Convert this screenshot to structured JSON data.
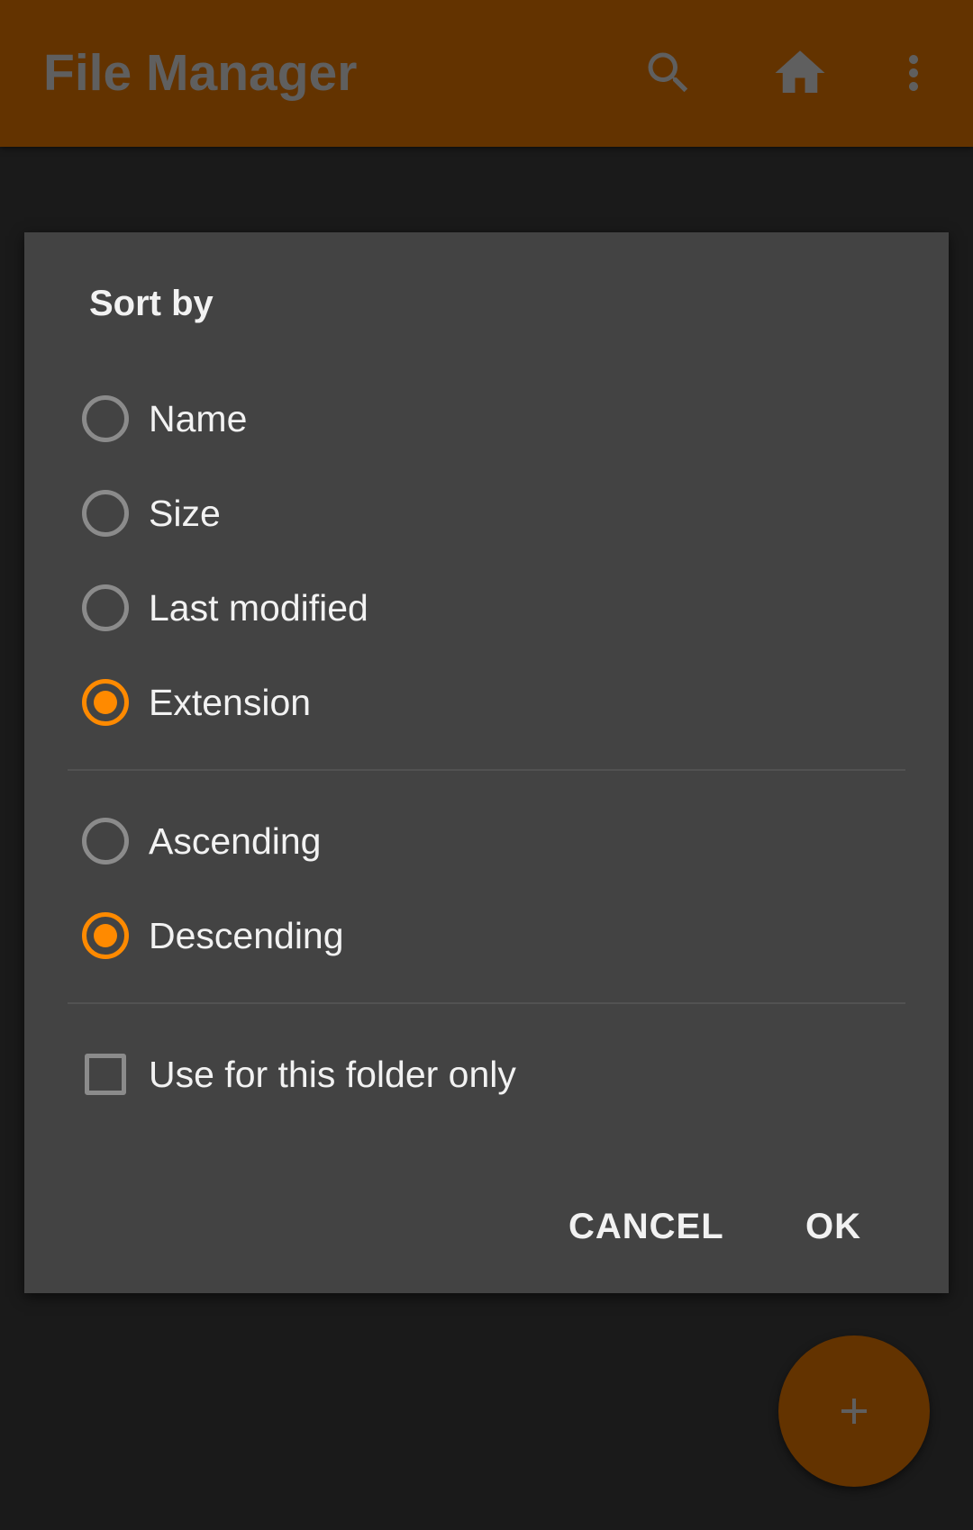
{
  "appbar": {
    "title": "File Manager",
    "icons": [
      "search-icon",
      "home-icon",
      "more-vert-icon"
    ],
    "background": "#633300"
  },
  "dialog": {
    "title": "Sort by",
    "sort_options": [
      {
        "label": "Name",
        "checked": false
      },
      {
        "label": "Size",
        "checked": false
      },
      {
        "label": "Last modified",
        "checked": false
      },
      {
        "label": "Extension",
        "checked": true
      }
    ],
    "order_options": [
      {
        "label": "Ascending",
        "checked": false
      },
      {
        "label": "Descending",
        "checked": true
      }
    ],
    "folder_only": {
      "label": "Use for this folder only",
      "checked": false
    },
    "cancel_label": "CANCEL",
    "ok_label": "OK"
  },
  "fab": {
    "icon": "plus-icon"
  },
  "colors": {
    "accent": "#ff8a00",
    "dialog_bg": "#434343",
    "screen_bg": "#1a1a1a"
  }
}
